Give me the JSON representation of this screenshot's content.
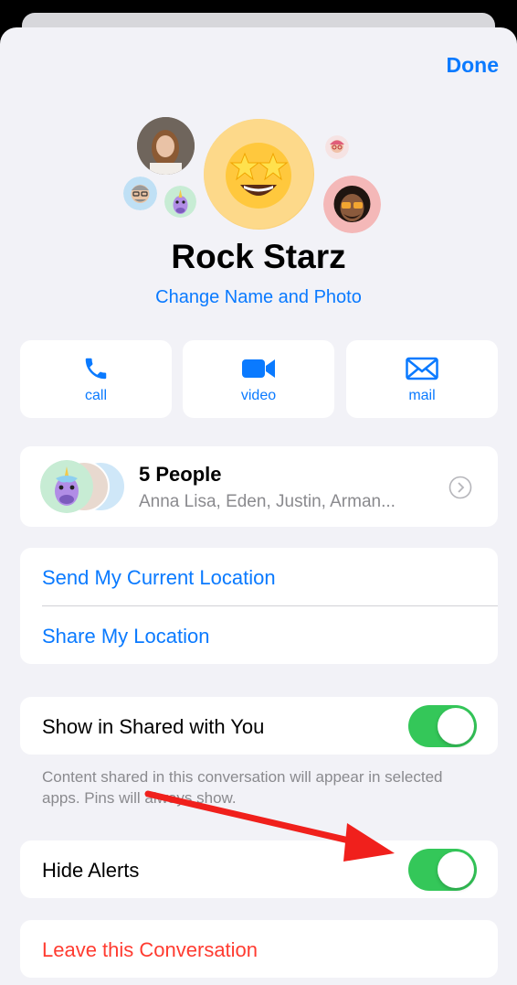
{
  "header": {
    "done_label": "Done"
  },
  "group": {
    "name": "Rock Starz",
    "change_label": "Change Name and Photo"
  },
  "actions": [
    {
      "label": "call",
      "icon": "phone-icon"
    },
    {
      "label": "video",
      "icon": "video-camera-icon"
    },
    {
      "label": "mail",
      "icon": "envelope-icon"
    }
  ],
  "people": {
    "title": "5 People",
    "names": "Anna Lisa, Eden, Justin, Arman..."
  },
  "location": {
    "send_current": "Send My Current Location",
    "share": "Share My Location"
  },
  "shared_with_you": {
    "label": "Show in Shared with You",
    "enabled": true,
    "footnote": "Content shared in this conversation will appear in selected apps. Pins will always show."
  },
  "hide_alerts": {
    "label": "Hide Alerts",
    "enabled": true
  },
  "leave": {
    "label": "Leave this Conversation"
  },
  "colors": {
    "accent": "#0a7aff",
    "destructive": "#ff3b30",
    "toggle_on": "#34c759",
    "annotation_arrow": "#f0201c"
  }
}
